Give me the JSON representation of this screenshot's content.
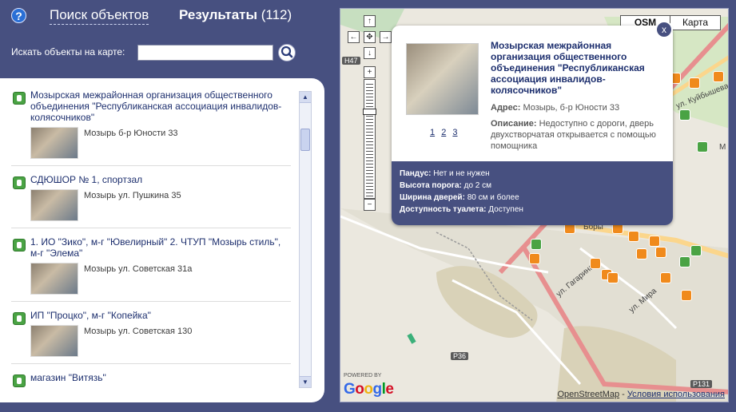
{
  "header": {
    "help_symbol": "?",
    "nav_search": "Поиск объектов",
    "results_label": "Результаты",
    "results_count": "(112)"
  },
  "search": {
    "label": "Искать объекты на карте:",
    "value": "",
    "placeholder": ""
  },
  "results": [
    {
      "title": "Мозырская межрайонная организация общественного объединения \"Республиканская ассоциация инвалидов-колясочников\"",
      "address": "Мозырь б-р Юности 33"
    },
    {
      "title": "СДЮШОР № 1, спортзал",
      "address": "Мозырь ул. Пушкина 35"
    },
    {
      "title": "1. ИО \"Зико\", м-г \"Ювелирный\" 2. ЧТУП \"Мозырь стиль\", м-г \"Элема\"",
      "address": "Мозырь ул. Советская 31а"
    },
    {
      "title": "ИП \"Процко\", м-г \"Копейка\"",
      "address": "Мозырь ул. Советская 130"
    },
    {
      "title": "магазин \"Витязь\"",
      "address": ""
    }
  ],
  "map": {
    "type_osm": "OSM",
    "type_karta": "Карта",
    "road_labels": {
      "h47": "Н47",
      "p36": "Р36",
      "p131": "Р131"
    },
    "streets": {
      "kuybysheva": "ул. Куйбышева",
      "gagarina": "ул. Гагарина",
      "mira": "ул. Мира",
      "bory": "Боры",
      "m": "М"
    },
    "credit_osm": "OpenStreetMap",
    "credit_terms": "Условия использования",
    "credit_sep": " - ",
    "powered_by": "POWERED BY",
    "pan_up": "↑",
    "pan_down": "↓",
    "pan_left": "←",
    "pan_right": "→",
    "pan_center": "✥",
    "zoom_in": "+",
    "zoom_out": "−"
  },
  "popup": {
    "title": "Мозырская межрайонная организация общественного объединения \"Республиканская ассоциация инвалидов-колясочников\"",
    "address_label": "Адрес:",
    "address_value": "Мозырь, б-р Юности 33",
    "desc_label": "Описание:",
    "desc_value": "Недоступно с дороги, дверь двухстворчатая открывается с помощью помощника",
    "pages": [
      "1",
      "2",
      "3"
    ],
    "close_symbol": "x",
    "attrs": [
      {
        "label": "Пандус:",
        "value": "Нет и не нужен"
      },
      {
        "label": "Высота порога:",
        "value": "до 2 см"
      },
      {
        "label": "Ширина дверей:",
        "value": "80 см и более"
      },
      {
        "label": "Доступность туалета:",
        "value": "Доступен"
      }
    ]
  },
  "colors": {
    "header_bg": "#475080",
    "link": "#1d2f6e",
    "marker_orange": "#f08a1c",
    "marker_green": "#4aa344"
  }
}
